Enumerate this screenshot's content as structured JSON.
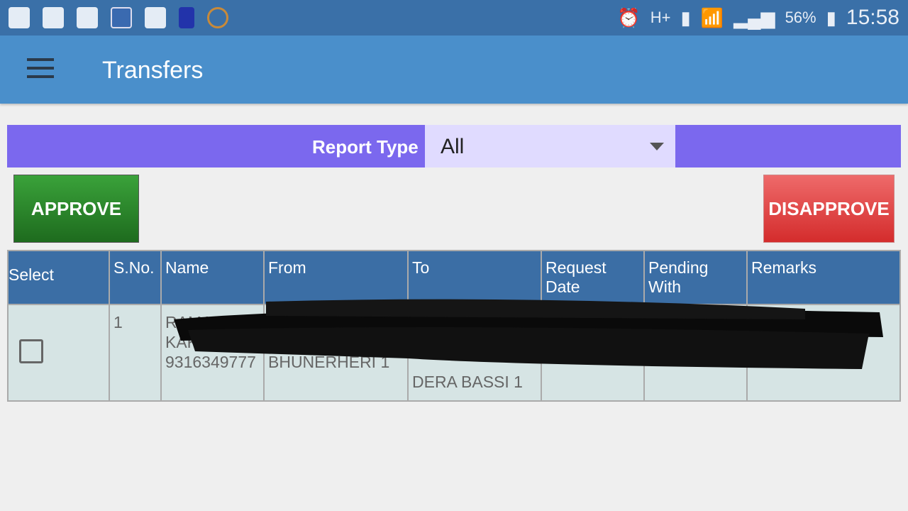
{
  "status_bar": {
    "battery": "56%",
    "time": "15:58",
    "icons": [
      "mail-icon",
      "hike-icon",
      "gallery-icon",
      "app-icon",
      "flipboard-icon",
      "sim-icon",
      "ucbrowser-icon",
      "alarm-icon",
      "hplus-data-icon",
      "sim1-icon",
      "signal-icon",
      "signal2-icon",
      "battery-icon"
    ]
  },
  "appbar": {
    "title": "Transfers"
  },
  "filter": {
    "label": "Report Type",
    "value": "All"
  },
  "actions": {
    "approve": "APPROVE",
    "disapprove": "DISAPPROVE"
  },
  "colors": {
    "appbar": "#4a8fcb",
    "filter": "#7b68ee",
    "approve": "#2e8b2e",
    "disapprove": "#e04848",
    "header": "#3b6ea5"
  },
  "table": {
    "headers": [
      "Select",
      "S.No.",
      "Name",
      "From",
      "To",
      "Request Date",
      "Pending With",
      "Remarks"
    ],
    "rows": [
      {
        "sno": "1",
        "name": [
          "RAMA",
          "KAK",
          "9316349777"
        ],
        "from": "BHUNERHERI 1",
        "to": "DERA BASSI 1",
        "request_date": "",
        "pending_with": "",
        "remarks": ""
      }
    ]
  }
}
